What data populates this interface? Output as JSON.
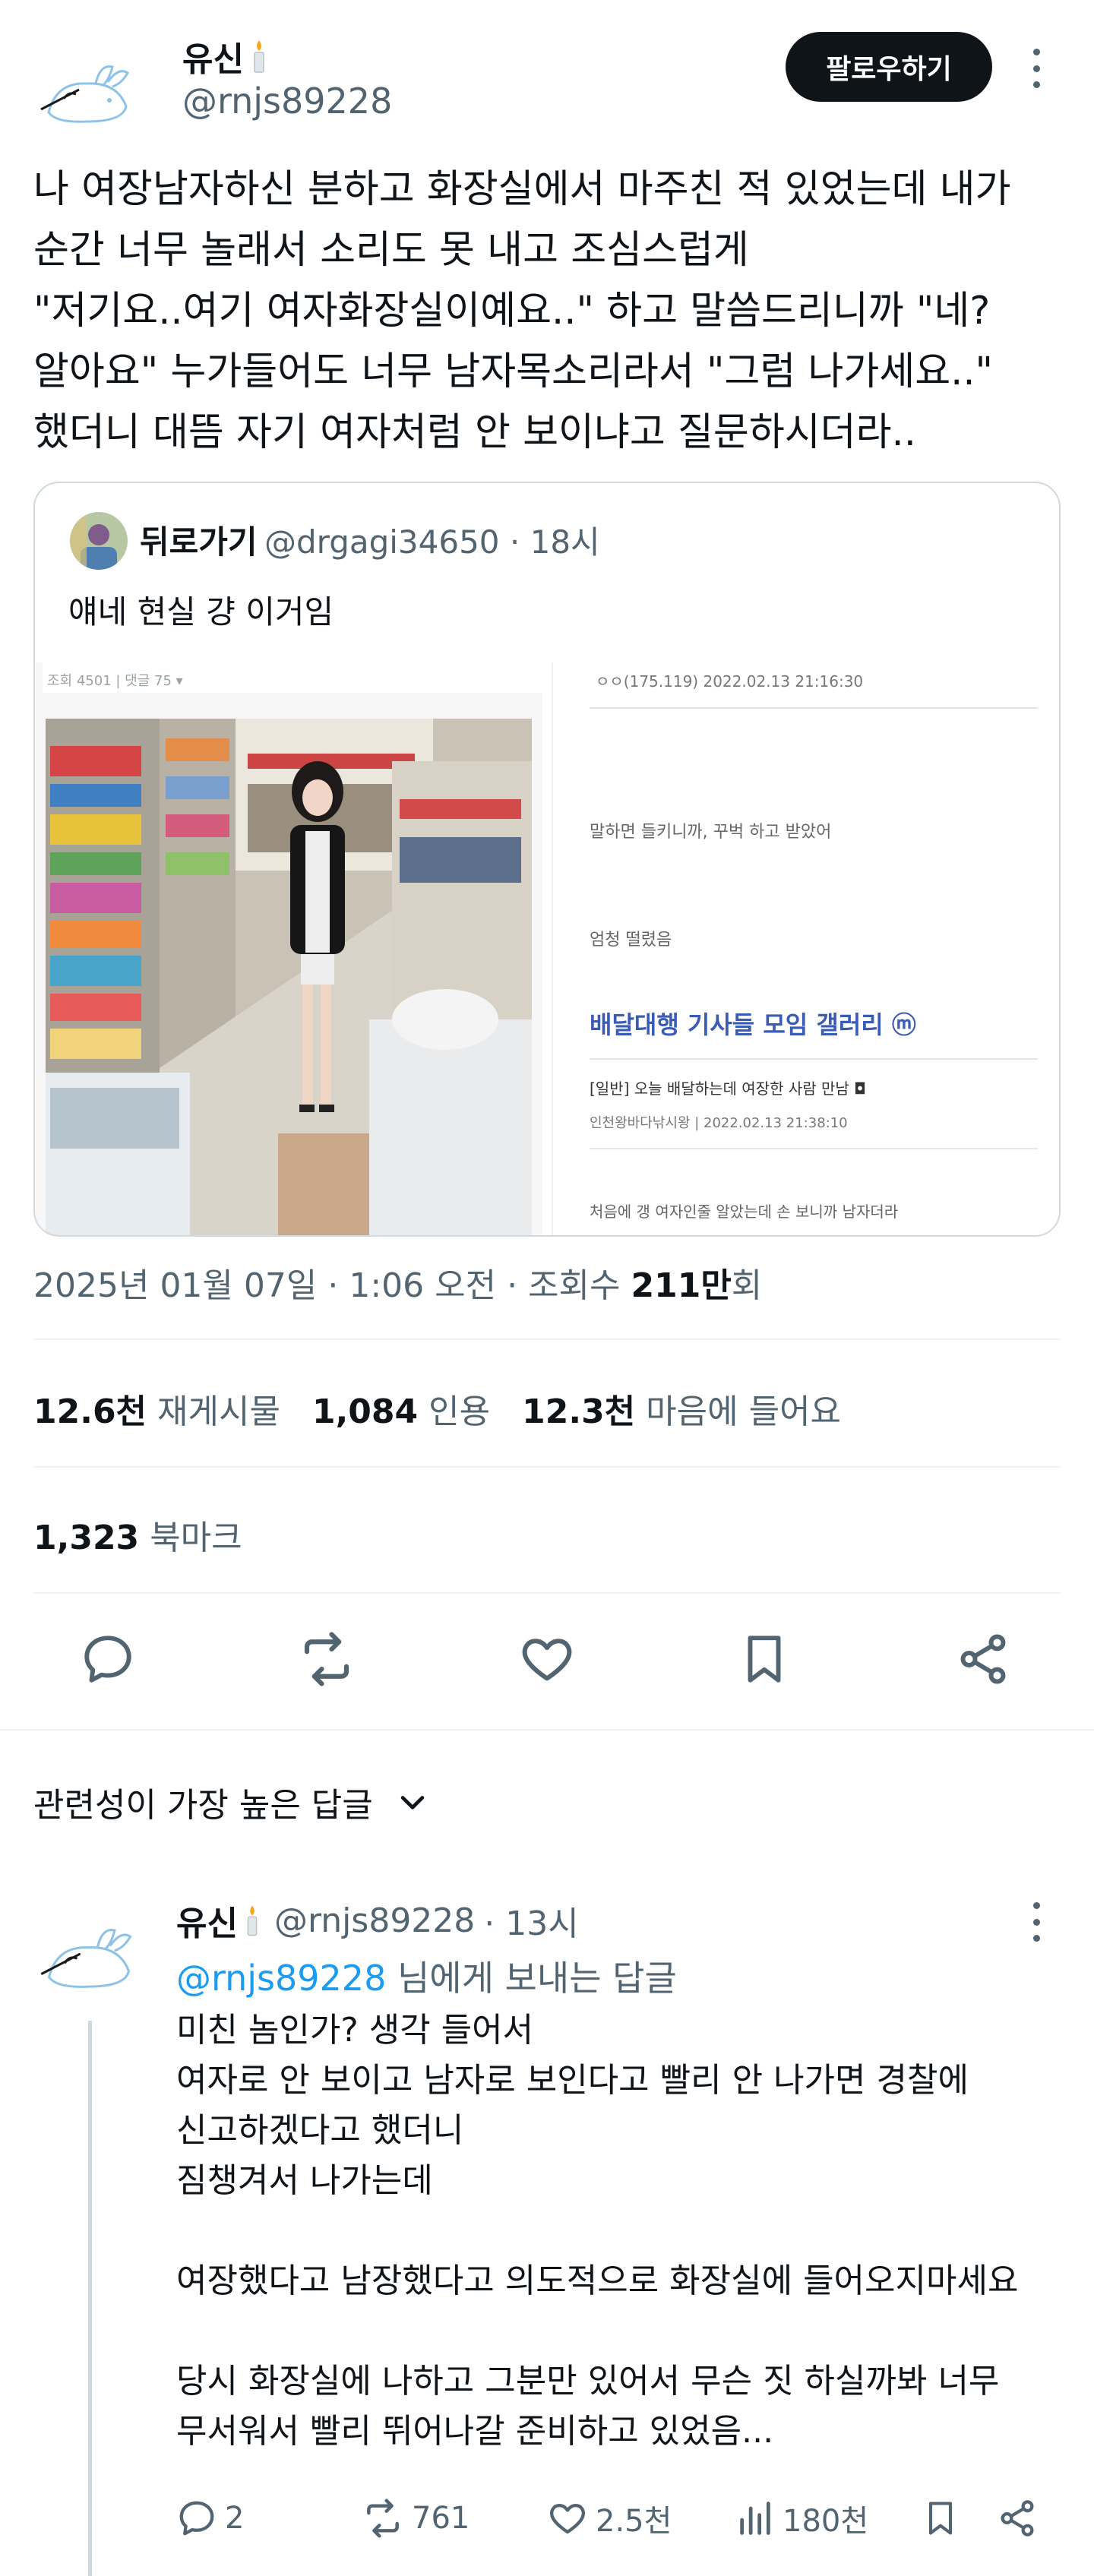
{
  "tweet": {
    "author_name": "유신",
    "author_handle": "@rnjs89228",
    "follow_label": "팔로우하기",
    "text_lines": [
      "나 여장남자하신 분하고 화장실에서 마주친 적 있었는데 내가",
      "순간 너무 놀래서 소리도 못 내고 조심스럽게",
      "\"저기요..여기 여자화장실이예요..\" 하고 말씀드리니까 \"네?",
      "알아요\" 누가들어도 너무 남자목소리라서 \"그럼 나가세요..\"",
      "했더니 대뜸 자기 여자처럼 안 보이냐고 질문하시더라.."
    ]
  },
  "quote": {
    "author_name": "뒤로가기",
    "author_handle": "@drgagi34650",
    "time": "· 18시",
    "text": "얘네 현실 걍 이거임",
    "image": {
      "top_left_header": "조회 4501 | 댓글 75 ▾",
      "comment_meta": "ㅇㅇ(175.119)    2022.02.13 21:16:30",
      "line1": "말하면 들키니까, 꾸벅 하고 받았어",
      "line2": "엄청 떨렸음",
      "gallery_title": "배달대행 기사들 모임 갤러리 ⓜ",
      "post_title": "[일반] 오늘 배달하는데 여장한 사람 만남 ◘",
      "post_meta": "인천왕바다낚시왕  |  2022.02.13 21:38:10",
      "post_body": "처음에 갱 여자인줄 알았는데 손 보니까 남자더라"
    }
  },
  "meta": {
    "date": "2025년 01월 07일 · 1:06 오전 · 조회수 ",
    "views": "211만",
    "views_suffix": "회"
  },
  "stats": {
    "retweets": "12.6천",
    "retweets_label": "재게시물",
    "quotes": "1,084",
    "quotes_label": "인용",
    "likes": "12.3천",
    "likes_label": "마음에 들어요",
    "bookmarks": "1,323",
    "bookmarks_label": "북마크"
  },
  "actions": [
    "reply-icon",
    "retweet-icon",
    "like-icon",
    "bookmark-icon",
    "share-icon"
  ],
  "sort": {
    "label": "관련성이 가장 높은 답글"
  },
  "reply": {
    "author_name": "유신",
    "author_handle": "@rnjs89228",
    "time": "· 13시",
    "reply_to_handle": "@rnjs89228",
    "reply_to_suffix": " 님에게 보내는 답글",
    "text_lines": [
      "미친 놈인가? 생각 들어서",
      "여자로 안 보이고 남자로 보인다고 빨리 안 나가면 경찰에",
      "신고하겠다고 했더니",
      "짐챙겨서 나가는데",
      "",
      "여장했다고 남장했다고 의도적으로 화장실에 들어오지마세요",
      "",
      "당시 화장실에 나하고 그분만 있어서 무슨 짓 하실까봐 너무",
      "무서워서 빨리 뛰어나갈 준비하고 있었음..."
    ],
    "replies": "2",
    "retweets": "761",
    "likes": "2.5천",
    "views": "180천"
  },
  "colors": {
    "accent": "#1d9bf0",
    "text": "#0f1419",
    "muted": "#536471",
    "border": "#cfd9de"
  }
}
